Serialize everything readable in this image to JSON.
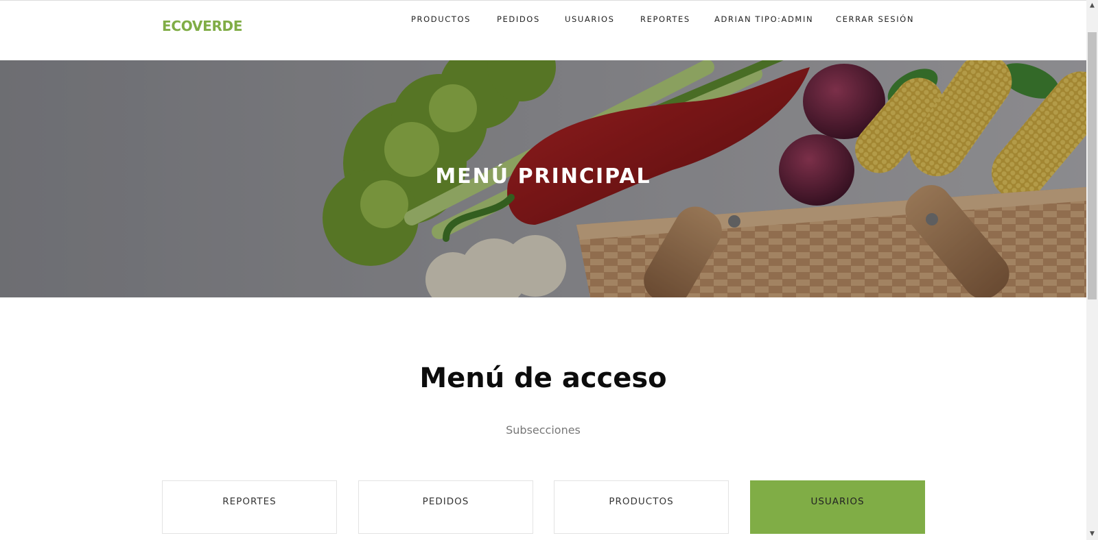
{
  "header": {
    "logo": "ECOVERDE",
    "nav": [
      {
        "label": "PRODUCTOS"
      },
      {
        "label": "PEDIDOS"
      },
      {
        "label": "USUARIOS"
      },
      {
        "label": "REPORTES"
      },
      {
        "label": "ADRIAN TIPO:ADMIN"
      },
      {
        "label": "CERRAR SESIÓN"
      }
    ]
  },
  "hero": {
    "title": "MENÚ PRINCIPAL"
  },
  "section": {
    "title": "Menú de acceso",
    "subtitle": "Subsecciones",
    "cards": [
      {
        "label": "REPORTES",
        "active": false
      },
      {
        "label": "PEDIDOS",
        "active": false
      },
      {
        "label": "PRODUCTOS",
        "active": false
      },
      {
        "label": "USUARIOS",
        "active": true
      }
    ]
  },
  "colors": {
    "brand_green": "#80ad46",
    "text_dark": "#222222",
    "hero_text": "#ffffff"
  },
  "scrollbar": {
    "up_icon": "triangle-up-icon",
    "down_icon": "triangle-down-icon"
  }
}
